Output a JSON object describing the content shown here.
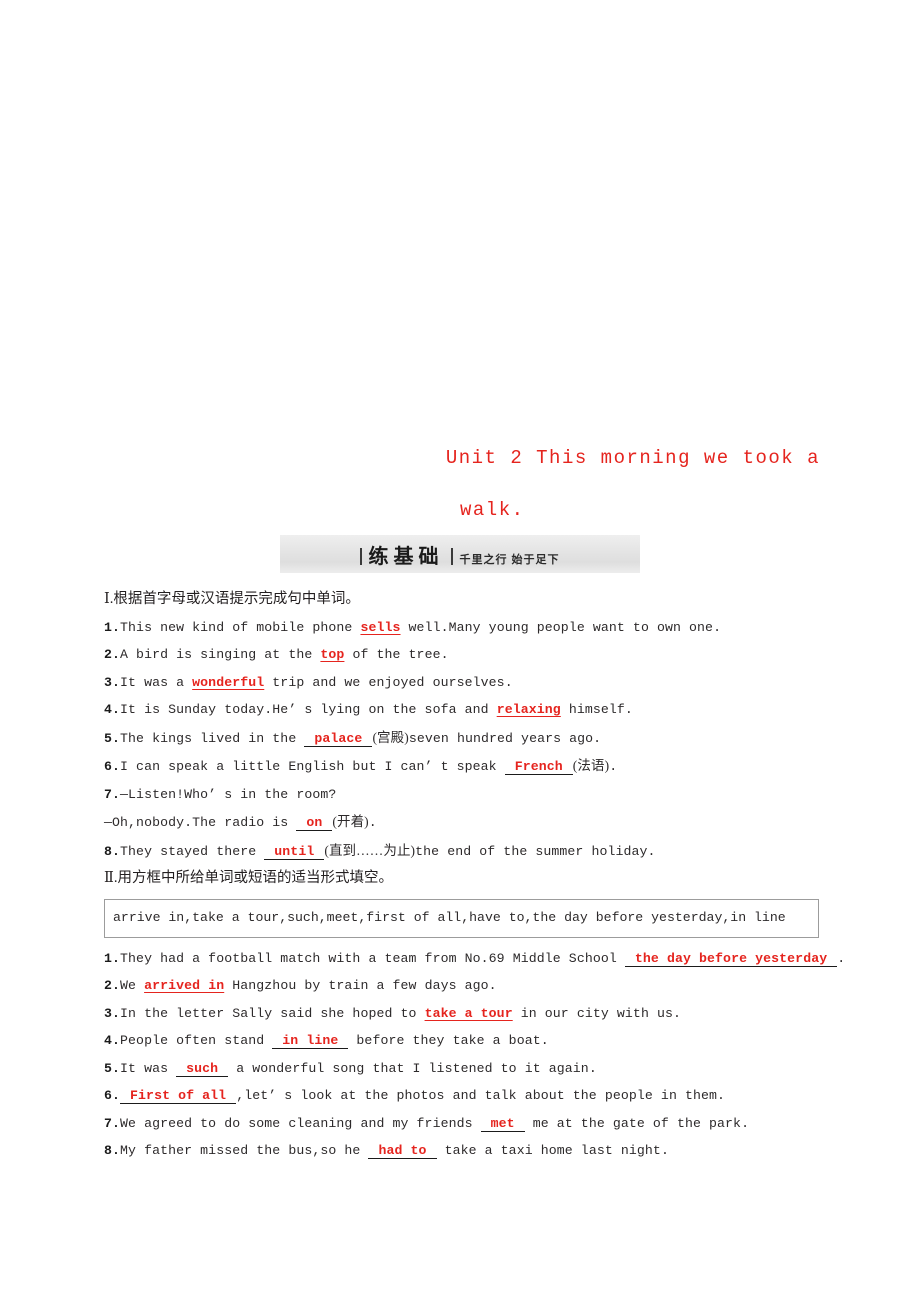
{
  "page": {
    "watermark": " ",
    "title_line1": "Unit 2  This morning we took a",
    "title_line2": "walk."
  },
  "banner": {
    "main_label": "练基础",
    "sub_label": "千里之行  始于足下",
    "accent_color": "#e5241e"
  },
  "section_one": {
    "heading": "Ⅰ.根据首字母或汉语提示完成句中单词。",
    "items": [
      {
        "num": "1.",
        "pre": "This new kind of mobile phone ",
        "answer": "sells",
        "answer_style": "underline",
        "post": " well.Many young people want to own one."
      },
      {
        "num": "2.",
        "pre": "A bird is singing at the ",
        "answer": "top",
        "answer_style": "underline",
        "post": " of the tree."
      },
      {
        "num": "3.",
        "pre": "It was a ",
        "answer": "wonderful",
        "answer_style": "underline",
        "post": " trip and we enjoyed ourselves."
      },
      {
        "num": "4.",
        "pre": "It is Sunday today.He’ s lying on the sofa and ",
        "answer": "relaxing",
        "answer_style": "underline",
        "post": " himself."
      },
      {
        "num": "5.",
        "pre": "The kings lived in the ",
        "answer": "palace",
        "answer_style": "blank",
        "post_cn": "(宫殿)",
        "post": "seven hundred years ago."
      },
      {
        "num": "6.",
        "pre": "I can speak a little English but I can’ t speak ",
        "answer": "French",
        "answer_style": "blank",
        "post_cn": "(法语)",
        "post": "."
      },
      {
        "num": "7.",
        "pre": "—Listen!Who’ s in the room?",
        "answer": "",
        "answer_style": "none",
        "post": ""
      },
      {
        "num": "",
        "pre": "—Oh,nobody.The radio is ",
        "answer": "on",
        "answer_style": "blank",
        "post_cn": "(开着)",
        "post": "."
      },
      {
        "num": "8.",
        "pre": "They stayed there ",
        "answer": "until",
        "answer_style": "blank",
        "post_cn": "(直到……为止)",
        "post": "the end of the summer holiday."
      }
    ]
  },
  "section_two": {
    "heading": "Ⅱ.用方框中所给单词或短语的适当形式填空。",
    "word_bank": "arrive in,take a tour,such,meet,first of all,have to,the day before yesterday,in line",
    "items": [
      {
        "num": "1.",
        "pre": "They had a football match with a team from No.69 Middle School ",
        "answer": "the day before yesterday",
        "answer_style": "blank-wrap",
        "post": "."
      },
      {
        "num": "2.",
        "pre": "We ",
        "answer": "arrived in",
        "answer_style": "underline",
        "post": " Hangzhou by train a few days ago."
      },
      {
        "num": "3.",
        "pre": "In the letter Sally said she hoped to ",
        "answer": "take a tour",
        "answer_style": "underline",
        "post": " in our city with us."
      },
      {
        "num": "4.",
        "pre": "People often stand ",
        "answer": "in line",
        "answer_style": "blank",
        "post": " before they take a boat."
      },
      {
        "num": "5.",
        "pre": "It was ",
        "answer": "such",
        "answer_style": "blank",
        "post": " a wonderful song that I listened to it again."
      },
      {
        "num": "6.",
        "pre": "",
        "answer": "First of all",
        "answer_style": "blank",
        "post": ",let’ s look at the photos and talk about the people in them."
      },
      {
        "num": "7.",
        "pre": "We agreed to do some cleaning and my friends ",
        "answer": "met",
        "answer_style": "blank",
        "post": " me at the gate of the park."
      },
      {
        "num": "8.",
        "pre": "My father missed the bus,so he ",
        "answer": "had to",
        "answer_style": "blank",
        "post": " take a taxi home last night."
      }
    ]
  }
}
